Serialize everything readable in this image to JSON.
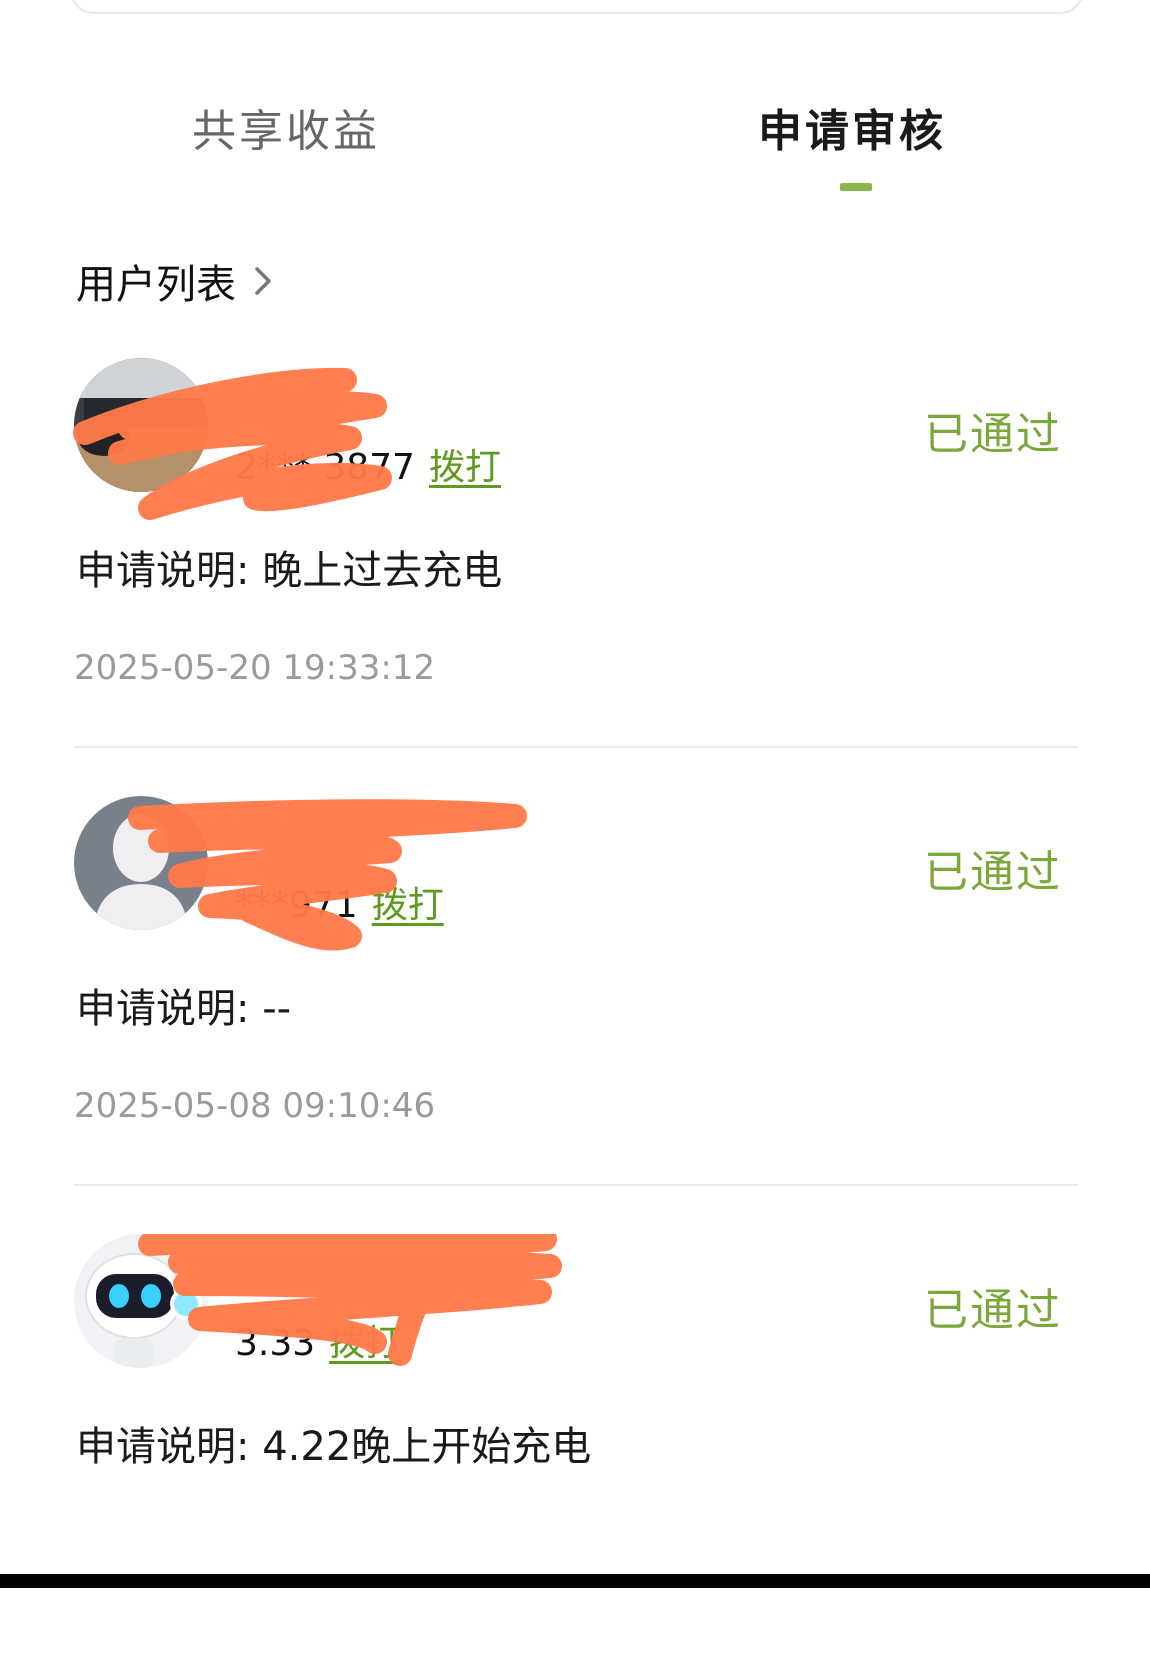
{
  "tabs": [
    {
      "label": "共享收益",
      "active": false
    },
    {
      "label": "申请审核",
      "active": true
    }
  ],
  "section": {
    "title": "用户列表"
  },
  "colors": {
    "accent": "#8bb44a",
    "status_text": "#7aa83a",
    "link": "#5e9a1e",
    "redaction": "#ff7a4a"
  },
  "records": [
    {
      "name": "",
      "phone": "2*** 3877",
      "dial_label": "拨打",
      "status": "已通过",
      "desc_label": "申请说明:",
      "desc_value": "晚上过去充电",
      "time": "2025-05-20 19:33:12",
      "avatar_icon": "car-interior-avatar"
    },
    {
      "name": "",
      "phone": "***971",
      "dial_label": "拨打",
      "status": "已通过",
      "desc_label": "申请说明:",
      "desc_value": "--",
      "time": "2025-05-08 09:10:46",
      "avatar_icon": "default-person-avatar"
    },
    {
      "name": "",
      "phone": "3.33",
      "dial_label": "拨打",
      "status": "已通过",
      "desc_label": "申请说明:",
      "desc_value": "4.22晚上开始充电",
      "avatar_icon": "robot-avatar"
    }
  ]
}
